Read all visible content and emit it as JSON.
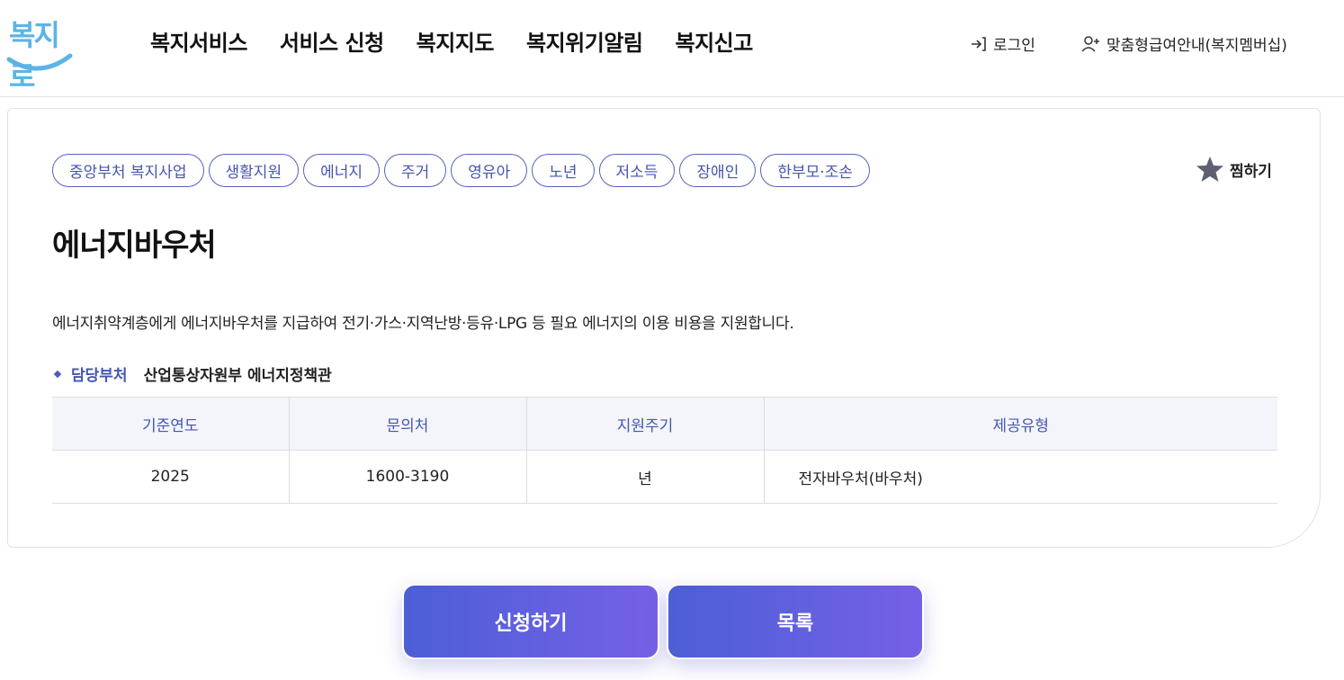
{
  "header": {
    "logo_text": "복지로",
    "nav": [
      "복지서비스",
      "서비스 신청",
      "복지지도",
      "복지위기알림",
      "복지신고"
    ],
    "login_label": "로그인",
    "member_label": "맞춤형급여안내(복지멤버십)"
  },
  "service": {
    "tags": [
      "중앙부처 복지사업",
      "생활지원",
      "에너지",
      "주거",
      "영유아",
      "노년",
      "저소득",
      "장애인",
      "한부모·조손"
    ],
    "favorite_label": "찜하기",
    "title": "에너지바우처",
    "description": "에너지취약계층에게 에너지바우처를 지급하여 전기·가스·지역난방·등유·LPG 등 필요 에너지의 이용 비용을 지원합니다.",
    "dept_label": "담당부처",
    "dept_value": "산업통상자원부 에너지정책관",
    "table": {
      "headers": [
        "기준연도",
        "문의처",
        "지원주기",
        "제공유형"
      ],
      "row": [
        "2025",
        "1600-3190",
        "년",
        "전자바우처(바우처)"
      ]
    }
  },
  "actions": {
    "apply_label": "신청하기",
    "list_label": "목록"
  },
  "colors": {
    "accent": "#4555b0",
    "logo": "#5cb4e6",
    "button_gradient_start": "#4c5fd6",
    "button_gradient_end": "#7560e6"
  }
}
